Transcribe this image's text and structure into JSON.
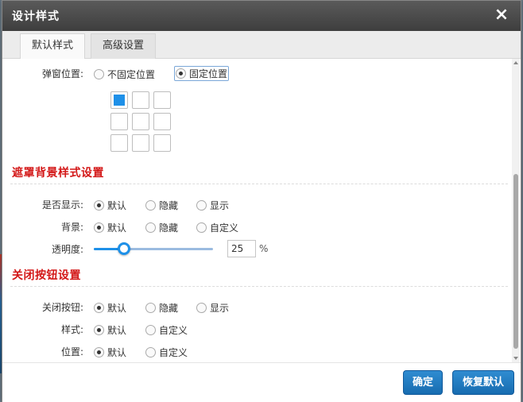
{
  "dialog": {
    "title": "设计样式",
    "close_icon": "×"
  },
  "tabs": [
    {
      "label": "默认样式",
      "active": true
    },
    {
      "label": "高级设置",
      "active": false
    }
  ],
  "popup_position": {
    "label": "弹窗位置:",
    "options": [
      "不固定位置",
      "固定位置"
    ],
    "selected": "固定位置",
    "grid_selected_cell": "top-left"
  },
  "mask_section": {
    "title": "遮罩背景样式设置",
    "show": {
      "label": "是否显示:",
      "options": [
        "默认",
        "隐藏",
        "显示"
      ],
      "selected": "默认"
    },
    "background": {
      "label": "背景:",
      "options": [
        "默认",
        "隐藏",
        "自定义"
      ],
      "selected": "默认"
    },
    "opacity": {
      "label": "透明度:",
      "value": "25",
      "unit": "%",
      "level": 0.25
    }
  },
  "close_section": {
    "title": "关闭按钮设置",
    "close_button": {
      "label": "关闭按钮:",
      "options": [
        "默认",
        "隐藏",
        "显示"
      ],
      "selected": "默认"
    },
    "style": {
      "label": "样式:",
      "options": [
        "默认",
        "自定义"
      ],
      "selected": "默认"
    },
    "position": {
      "label": "位置:",
      "options": [
        "默认",
        "自定义"
      ],
      "selected": "默认"
    }
  },
  "footer": {
    "confirm_label": "确定",
    "reset_label": "恢复默认"
  },
  "colors": {
    "accent": "#1e90e8",
    "section_title": "#d31717",
    "titlebar": "#4a4a4a",
    "button": "#1e78c0"
  }
}
